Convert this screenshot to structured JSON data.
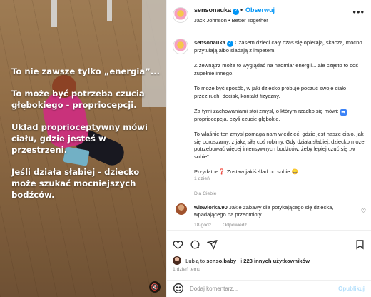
{
  "post": {
    "username": "sensonauka",
    "follow_label": "Obserwuj",
    "dot": "•",
    "song": "Jack Johnson • Better Together",
    "more": "•••"
  },
  "media": {
    "overlay": [
      "To nie zawsze tylko „energia”...",
      "To może być potrzeba czucia\ngłębokiego - propriocepcji.",
      "Układ proprioceptywny mówi\nciału, gdzie jesteś w\nprzestrzeni.",
      "Jeśli działa słabiej - dziecko\nmoże szukać mocniejszych\nbodźców."
    ],
    "mute_icon": "🔇"
  },
  "caption": {
    "username": "sensonauka",
    "first": "Czasem dzieci cały czas się opierają, skaczą, mocno przytulają albo siadają z impetem.",
    "p2": "Z zewnątrz może to wyglądać na nadmiar energii... ale często to coś zupełnie innego.",
    "p3": "To może być sposób, w jaki dziecko próbuje poczuć swoje ciało — przez ruch, docisk, kontakt fizyczny.",
    "p4_a": "Za tymi zachowaniami stoi zmysł, o którym rzadko się mówi:",
    "p4_icon": "➡",
    "p4_b": "propriocepcja, czyli czucie głębokie.",
    "p5": "To właśnie ten zmysł pomaga nam wiedzieć, gdzie jest nasze ciało, jak się poruszamy, z jaką siłą coś robimy. Gdy działa słabiej, dziecko może potrzebować więcej intensywnych bodźców, żeby lepiej czuć się „w sobie”.",
    "p6_a": "Przydatne",
    "p6_q": "❓",
    "p6_b": "Zostaw jakiś ślad po sobie",
    "p6_e": "😄",
    "time": "1 dzień",
    "likes_you": "Dla Ciebie"
  },
  "comment": {
    "username": "wiewiorka.90",
    "text": "Jakie zabawy dla potykającego się dziecka, wpadającego na przedmioty.",
    "time": "18 godz.",
    "reply": "Odpowiedz"
  },
  "likes": {
    "prefix": "Lubią to",
    "user": "senso.baby_",
    "mid": "i",
    "others": "223 innych użytkowników",
    "time": "1 dzień temu"
  },
  "add_comment": {
    "placeholder": "Dodaj komentarz...",
    "post_label": "Opublikuj"
  },
  "icons": [
    "heart-icon",
    "comment-icon",
    "share-icon",
    "bookmark-icon",
    "smile-icon",
    "mute-icon",
    "more-icon",
    "verified-icon"
  ]
}
